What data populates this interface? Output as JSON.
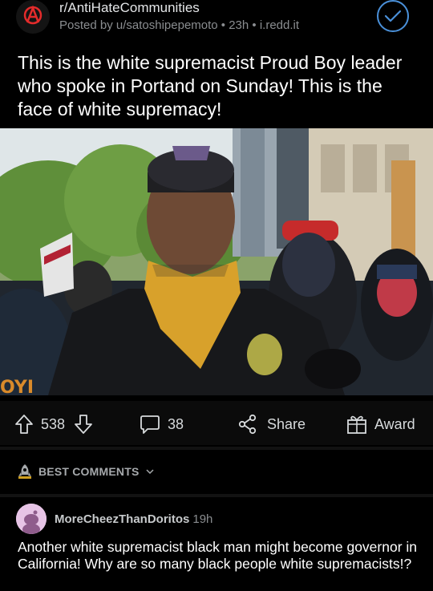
{
  "post": {
    "subreddit": "r/AntiHateCommunities",
    "meta": "Posted by u/satoshipepemoto • 23h • i.redd.it",
    "title": "This is the white supremacist Proud Boy leader who spoke in Portand on Sunday! This is the face of white supremacy!",
    "image_sign_text": "OYI"
  },
  "actions": {
    "upvotes": "538",
    "comments": "38",
    "share_label": "Share",
    "award_label": "Award"
  },
  "sort": {
    "label": "BEST COMMENTS"
  },
  "comment": {
    "username": "MoreCheezThanDoritos",
    "time": "19h",
    "body": "Another white supremacist black man might become governor in California! Why are so many black people white supremacists!?"
  },
  "colors": {
    "accent": "#4a90d9",
    "sub_icon": "#e32b2b",
    "avatar_bg": "#e7c4e6"
  }
}
